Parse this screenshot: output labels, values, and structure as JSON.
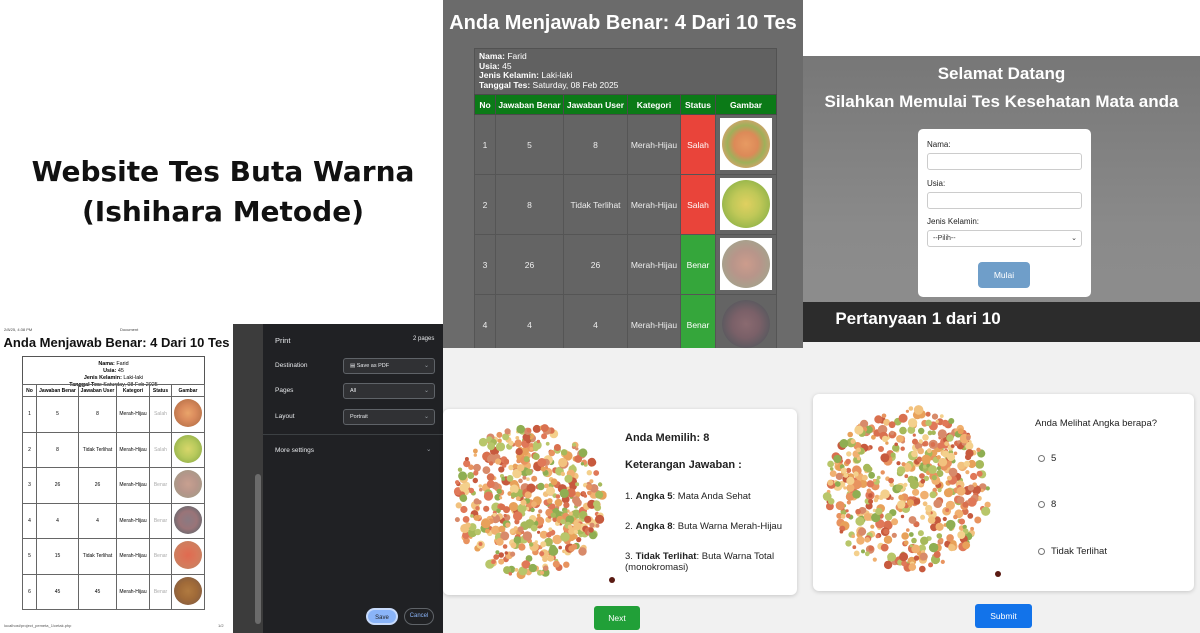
{
  "site": {
    "title_line1": "Website Tes Buta Warna",
    "title_line2": "(Ishihara Metode)"
  },
  "print_doc": {
    "header_left": "2/8/25, 4:38 PM",
    "header_center": "Document",
    "title": "Anda Menjawab Benar: 4 Dari 10 Tes",
    "info": {
      "nama_label": "Nama:",
      "nama": "Farid",
      "usia_label": "Usia:",
      "usia": "45",
      "jk_label": "Jenis Kelamin:",
      "jk": "Laki-laki",
      "tgl_label": "Tanggal Tes:",
      "tgl": "Saturday, 08 Feb 2025"
    },
    "columns": [
      "No",
      "Jawaban Benar",
      "Jawaban User",
      "Kategori",
      "Status",
      "Gambar"
    ],
    "rows": [
      {
        "no": "1",
        "benar": "5",
        "user": "8",
        "kategori": "Merah-Hijau",
        "status": "Salah"
      },
      {
        "no": "2",
        "benar": "8",
        "user": "Tidak Terlihat",
        "kategori": "Merah-Hijau",
        "status": "Salah"
      },
      {
        "no": "3",
        "benar": "26",
        "user": "26",
        "kategori": "Merah-Hijau",
        "status": "Benar"
      },
      {
        "no": "4",
        "benar": "4",
        "user": "4",
        "kategori": "Merah-Hijau",
        "status": "Benar"
      },
      {
        "no": "5",
        "benar": "15",
        "user": "Tidak Terlihat",
        "kategori": "Merah-Hijau",
        "status": "Benar"
      },
      {
        "no": "6",
        "benar": "45",
        "user": "45",
        "kategori": "Merah-Hijau",
        "status": "Benar"
      }
    ],
    "footer_left": "localhost/project_pemeta_1/cetak.php",
    "footer_right": "1/2"
  },
  "print_dialog": {
    "title": "Print",
    "pages_count": "2 pages",
    "destination_label": "Destination",
    "destination_value": "Save as PDF",
    "pages_label": "Pages",
    "pages_value": "All",
    "layout_label": "Layout",
    "layout_value": "Portrait",
    "more_settings": "More settings",
    "save_label": "Save",
    "cancel_label": "Cancel"
  },
  "result": {
    "title": "Anda Menjawab Benar: 4 Dari 10 Tes",
    "info": {
      "nama_label": "Nama:",
      "nama": "Farid",
      "usia_label": "Usia:",
      "usia": "45",
      "jk_label": "Jenis Kelamin:",
      "jk": "Laki-laki",
      "tgl_label": "Tanggal Tes:",
      "tgl": "Saturday, 08 Feb 2025"
    },
    "columns": [
      "No",
      "Jawaban Benar",
      "Jawaban User",
      "Kategori",
      "Status",
      "Gambar"
    ],
    "rows": [
      {
        "no": "1",
        "benar": "5",
        "user": "8",
        "kategori": "Merah-Hijau",
        "status": "Salah"
      },
      {
        "no": "2",
        "benar": "8",
        "user": "Tidak Terlihat",
        "kategori": "Merah-Hijau",
        "status": "Salah"
      },
      {
        "no": "3",
        "benar": "26",
        "user": "26",
        "kategori": "Merah-Hijau",
        "status": "Benar"
      },
      {
        "no": "4",
        "benar": "4",
        "user": "4",
        "kategori": "Merah-Hijau",
        "status": "Benar"
      }
    ]
  },
  "welcome": {
    "line1": "Selamat Datang",
    "line2": "Silahkan Memulai Tes Kesehatan Mata anda",
    "nama_label": "Nama:",
    "usia_label": "Usia:",
    "jk_label": "Jenis Kelamin:",
    "jk_placeholder": "--Pilih--",
    "mulai_label": "Mulai",
    "question_counter": "Pertanyaan 1 dari 10"
  },
  "answer": {
    "choice": "Anda Memilih: 8",
    "heading": "Keterangan Jawaban :",
    "items": [
      {
        "prefix": "1. ",
        "bold": "Angka 5",
        "text": ": Mata Anda Sehat"
      },
      {
        "prefix": "2. ",
        "bold": "Angka 8",
        "text": ": Buta Warna Merah-Hijau"
      },
      {
        "prefix": "3. ",
        "bold": "Tidak Terlihat",
        "text": ": Buta Warna Total (monokromasi)"
      }
    ],
    "next_label": "Next"
  },
  "question": {
    "text": "Anda Melihat Angka berapa?",
    "options": [
      "5",
      "8",
      "Tidak Terlihat"
    ],
    "submit_label": "Submit"
  },
  "colors": {
    "green_header": "#0b7a17",
    "salah": "#e9443a",
    "benar": "#35a63b",
    "next": "#21a038",
    "submit": "#1273ea",
    "mulai": "#6f9ec9"
  }
}
